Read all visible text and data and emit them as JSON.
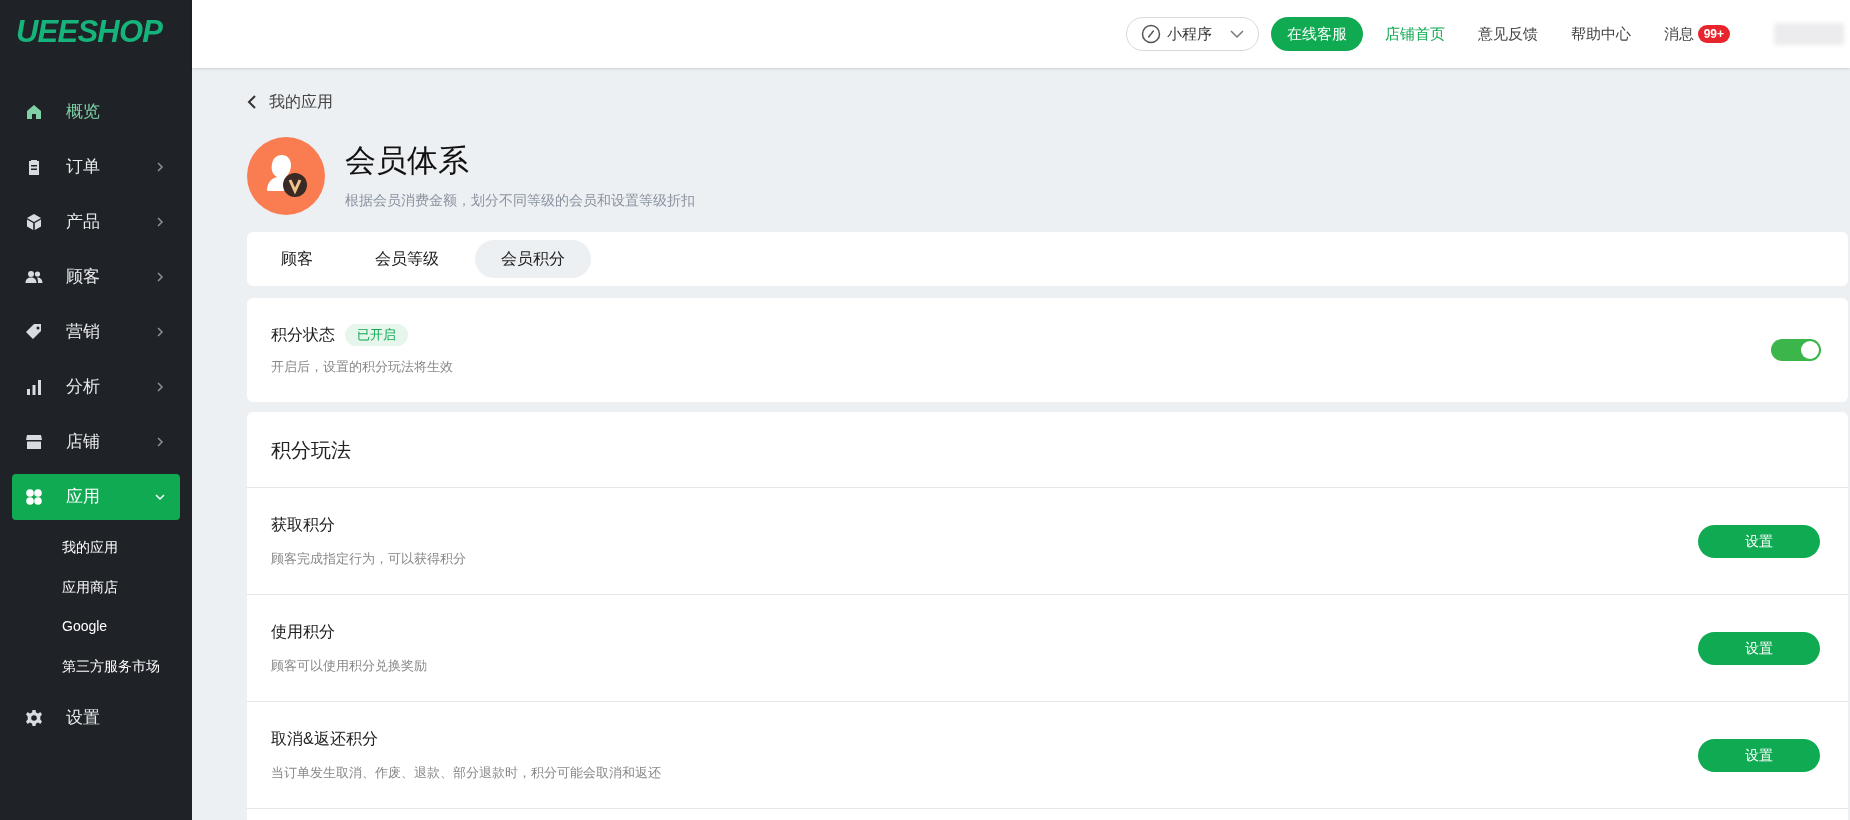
{
  "logo": "UEESHOP",
  "sidebar": {
    "items": [
      {
        "label": "概览",
        "active": true,
        "selected": false,
        "expandable": false
      },
      {
        "label": "订单",
        "active": false,
        "selected": false,
        "expandable": true,
        "expanded": false
      },
      {
        "label": "产品",
        "active": false,
        "selected": false,
        "expandable": true,
        "expanded": false
      },
      {
        "label": "顾客",
        "active": false,
        "selected": false,
        "expandable": true,
        "expanded": false
      },
      {
        "label": "营销",
        "active": false,
        "selected": false,
        "expandable": true,
        "expanded": false
      },
      {
        "label": "分析",
        "active": false,
        "selected": false,
        "expandable": true,
        "expanded": false
      },
      {
        "label": "店铺",
        "active": false,
        "selected": false,
        "expandable": true,
        "expanded": false
      },
      {
        "label": "应用",
        "active": false,
        "selected": true,
        "expandable": true,
        "expanded": true,
        "children": [
          {
            "label": "我的应用"
          },
          {
            "label": "应用商店"
          },
          {
            "label": "Google"
          },
          {
            "label": "第三方服务市场"
          }
        ]
      },
      {
        "label": "设置",
        "active": false,
        "selected": false,
        "expandable": false
      }
    ]
  },
  "topbar": {
    "dropdown": "小程序",
    "service_button": "在线客服",
    "links": [
      {
        "label": "店铺首页",
        "selected": true
      },
      {
        "label": "意见反馈",
        "selected": false
      },
      {
        "label": "帮助中心",
        "selected": false
      }
    ],
    "messages": {
      "label": "消息",
      "badge": "99+"
    }
  },
  "back_link": "我的应用",
  "app": {
    "title": "会员体系",
    "subtitle": "根据会员消费金额，划分不同等级的会员和设置等级折扣"
  },
  "tabs": [
    {
      "label": "顾客",
      "selected": false
    },
    {
      "label": "会员等级",
      "selected": false
    },
    {
      "label": "会员积分",
      "selected": true
    }
  ],
  "status_card": {
    "title": "积分状态",
    "badge": "已开启",
    "description": "开启后，设置的积分玩法将生效",
    "on": true
  },
  "rules_card": {
    "heading": "积分玩法",
    "rows": [
      {
        "title": "获取积分",
        "description": "顾客完成指定行为，可以获得积分",
        "button": "设置"
      },
      {
        "title": "使用积分",
        "description": "顾客可以使用积分兑换奖励",
        "button": "设置"
      },
      {
        "title": "取消&返还积分",
        "description": "当订单发生取消、作废、退款、部分退款时，积分可能会取消和返还",
        "button": "设置"
      }
    ]
  }
}
